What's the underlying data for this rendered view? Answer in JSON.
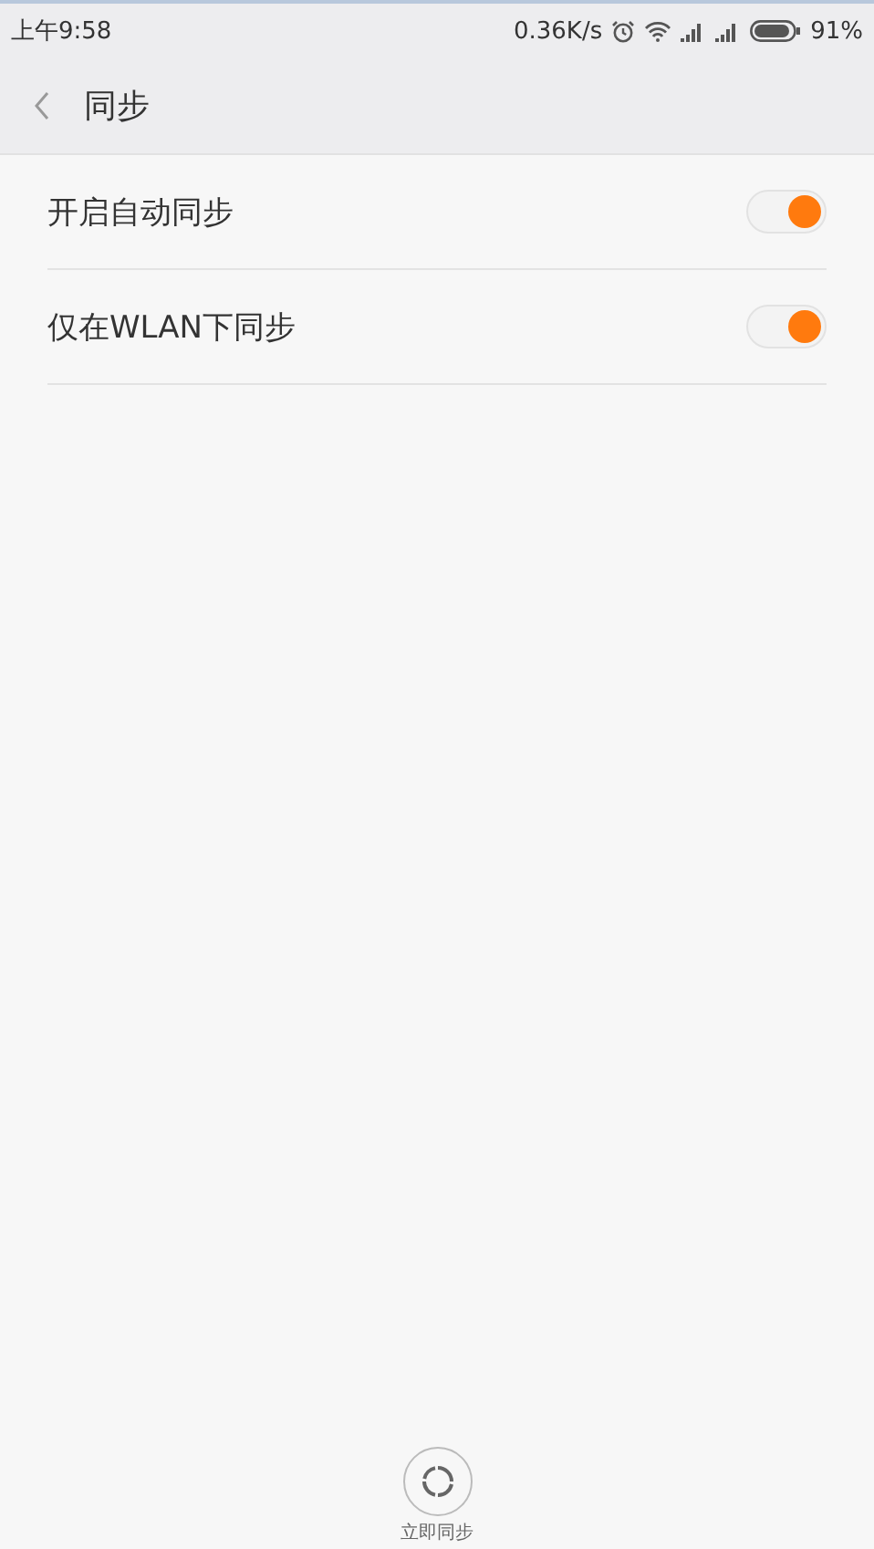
{
  "status_bar": {
    "time": "上午9:58",
    "speed": "0.36K/s",
    "battery": "91%"
  },
  "header": {
    "title": "同步"
  },
  "settings": [
    {
      "label": "开启自动同步",
      "on": true
    },
    {
      "label": "仅在WLAN下同步",
      "on": true
    }
  ],
  "sync_button": {
    "label": "立即同步"
  }
}
